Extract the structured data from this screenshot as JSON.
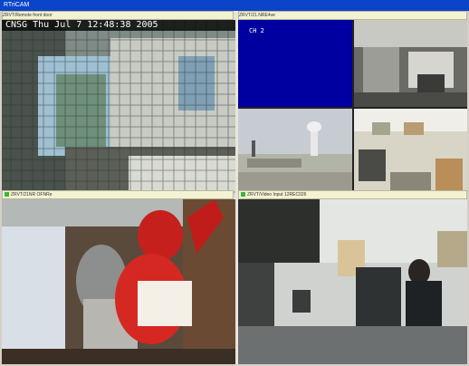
{
  "window": {
    "title": "RTriCAM"
  },
  "cameras": [
    {
      "caption": "ZRVT/Remote front door",
      "overlay": "CNSG Thu Jul  7 12:48:38 2005"
    },
    {
      "caption": "ZRVT/21.NRE4ve"
    },
    {
      "caption": "ZRVT/21NR OFNRe"
    },
    {
      "caption": "ZRVT/Video Input 12REC026"
    }
  ],
  "quad": {
    "channel_label": "CH 2"
  },
  "colors": {
    "titlebar": "#0a44c9",
    "channel_bg": "#0000a0",
    "status_dot": "#3bb53b"
  }
}
